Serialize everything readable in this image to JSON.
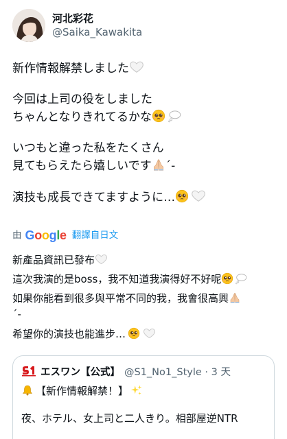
{
  "author": {
    "display_name": "河北彩花",
    "handle": "@Saika_Kawakita"
  },
  "tweet": {
    "lines": [
      "新作情報解禁しました",
      "今回は上司の役をしました",
      "ちゃんとなりきれてるかな",
      "いつもと違った私をたくさん",
      "見てもらえたら嬉しいです",
      "演技も成長できてますように…"
    ],
    "line2_suffix": "´-"
  },
  "translation": {
    "by_label": "由",
    "provider": "Google",
    "link_label": "翻譯自日文",
    "lines": [
      "新產品資訊已發布",
      "這次我演的是boss，我不知道我演得好不好呢",
      "如果你能看到很多與平常不同的我，我會很高興",
      "´-",
      "希望你的演技也能進步…"
    ]
  },
  "quoted_tweet": {
    "name": "エスワン【公式】",
    "handle_time": "@S1_No1_Style · 3 天",
    "line1": "【新作情報解禁！】",
    "line2": "夜、ホテル、女上司と二人きり。相部屋逆NTR"
  },
  "icons": {
    "white_heart": "white-heart-icon",
    "pleading_face": "pleading-face-icon",
    "thought_balloon": "thought-balloon-icon",
    "folded_hands": "folded-hands-icon",
    "bell": "bell-icon",
    "sparkles": "sparkles-icon",
    "s1_logo": "s1-logo-icon"
  },
  "colors": {
    "link": "#1d9bf0",
    "secondary_text": "#536471",
    "border": "#cfd9de"
  }
}
